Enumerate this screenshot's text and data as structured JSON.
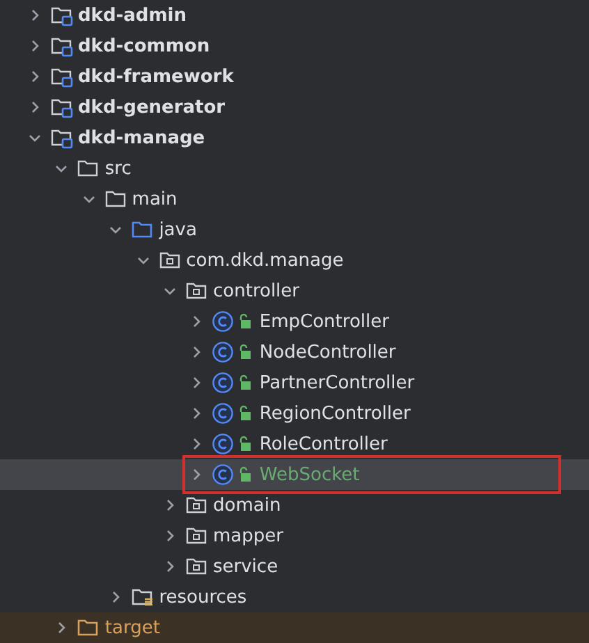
{
  "tree": [
    {
      "label": "dkd-admin",
      "kind": "module",
      "expanded": false,
      "selected": false
    },
    {
      "label": "dkd-common",
      "kind": "module",
      "expanded": false,
      "selected": false
    },
    {
      "label": "dkd-framework",
      "kind": "module",
      "expanded": false,
      "selected": false
    },
    {
      "label": "dkd-generator",
      "kind": "module",
      "expanded": false,
      "selected": false
    },
    {
      "label": "dkd-manage",
      "kind": "module",
      "expanded": true,
      "selected": false,
      "children": [
        {
          "label": "src",
          "kind": "folder",
          "expanded": true,
          "selected": false,
          "children": [
            {
              "label": "main",
              "kind": "folder",
              "expanded": true,
              "selected": false,
              "children": [
                {
                  "label": "java",
                  "kind": "source",
                  "expanded": true,
                  "selected": false,
                  "children": [
                    {
                      "label": "com.dkd.manage",
                      "kind": "package",
                      "expanded": true,
                      "selected": false,
                      "children": [
                        {
                          "label": "controller",
                          "kind": "package",
                          "expanded": true,
                          "selected": false,
                          "children": [
                            {
                              "label": "EmpController",
                              "kind": "class",
                              "expanded": false,
                              "selected": false,
                              "added": false,
                              "annotated": false
                            },
                            {
                              "label": "NodeController",
                              "kind": "class",
                              "expanded": false,
                              "selected": false,
                              "added": false,
                              "annotated": false
                            },
                            {
                              "label": "PartnerController",
                              "kind": "class",
                              "expanded": false,
                              "selected": false,
                              "added": false,
                              "annotated": false
                            },
                            {
                              "label": "RegionController",
                              "kind": "class",
                              "expanded": false,
                              "selected": false,
                              "added": false,
                              "annotated": false
                            },
                            {
                              "label": "RoleController",
                              "kind": "class",
                              "expanded": false,
                              "selected": false,
                              "added": false,
                              "annotated": false
                            },
                            {
                              "label": "WebSocket",
                              "kind": "class",
                              "expanded": false,
                              "selected": true,
                              "added": true,
                              "annotated": true
                            }
                          ]
                        },
                        {
                          "label": "domain",
                          "kind": "package",
                          "expanded": false,
                          "selected": false
                        },
                        {
                          "label": "mapper",
                          "kind": "package",
                          "expanded": false,
                          "selected": false
                        },
                        {
                          "label": "service",
                          "kind": "package",
                          "expanded": false,
                          "selected": false
                        }
                      ]
                    }
                  ]
                },
                {
                  "label": "resources",
                  "kind": "resources",
                  "expanded": false,
                  "selected": false
                }
              ]
            }
          ]
        },
        {
          "label": "target",
          "kind": "excluded",
          "expanded": false,
          "selected": false
        }
      ]
    }
  ]
}
